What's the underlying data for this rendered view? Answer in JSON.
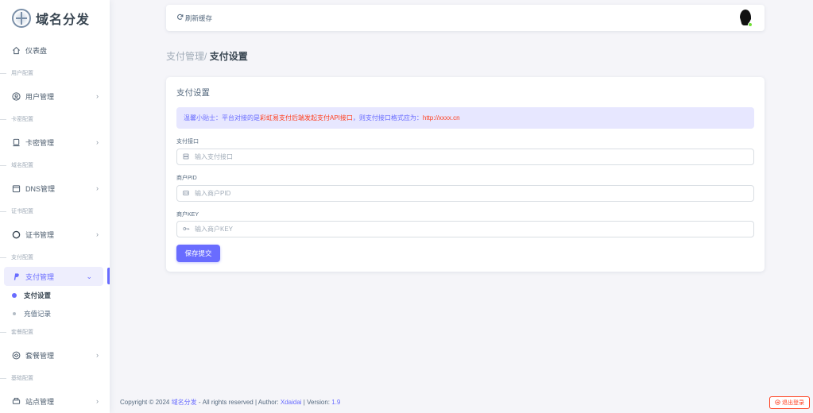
{
  "brand": {
    "name": "域名分发"
  },
  "sidebar": {
    "dashboard": "仪表盘",
    "sections": [
      {
        "header": "用户配置",
        "item": "用户管理"
      },
      {
        "header": "卡密配置",
        "item": "卡密管理"
      },
      {
        "header": "域名配置",
        "item": "DNS管理"
      },
      {
        "header": "证书配置",
        "item": "证书管理"
      },
      {
        "header": "支付配置",
        "item": "支付管理"
      },
      {
        "header": "套餐配置",
        "item": "套餐管理"
      },
      {
        "header": "基础配置",
        "item": "站点管理"
      }
    ],
    "pay_sub": [
      "支付设置",
      "充值记录"
    ]
  },
  "navbar": {
    "refresh_label": "刷新缓存"
  },
  "breadcrumb": {
    "parent": "支付管理/",
    "current": "支付设置"
  },
  "card": {
    "title": "支付设置",
    "alert": {
      "prefix": "温馨小贴士：平台对接的是",
      "highlight": "彩虹易支付后端发起支付API接口",
      "middle": "，则支付接口格式应为：",
      "url": "http://xxxx.cn"
    },
    "fields": [
      {
        "label": "支付接口",
        "placeholder": "输入支付接口",
        "icon": "server-icon"
      },
      {
        "label": "商户PID",
        "placeholder": "输入商户PID",
        "icon": "id-card-icon"
      },
      {
        "label": "商户KEY",
        "placeholder": "输入商户KEY",
        "icon": "key-icon"
      }
    ],
    "submit": "保存提交"
  },
  "footer": {
    "copyright": "Copyright © 2024",
    "site": "域名分发",
    "rights": "- All rights reserved | Author:",
    "author": "Xdaidai",
    "version_label": "| Version:",
    "version": "1.9"
  },
  "logout": "退出登录",
  "colors": {
    "primary": "#696cff",
    "danger": "#ff3e1d",
    "status_online": "#71dd37"
  }
}
